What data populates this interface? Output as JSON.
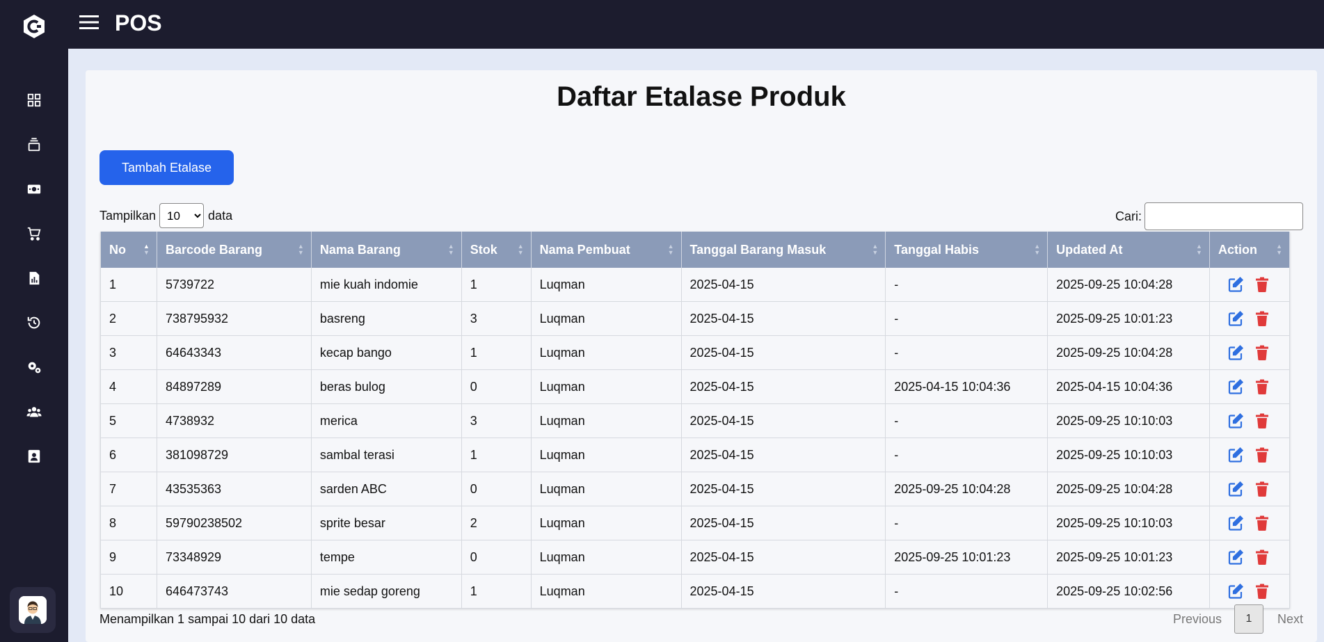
{
  "app": {
    "title": "POS"
  },
  "page": {
    "title": "Daftar Etalase Produk"
  },
  "actions": {
    "add_label": "Tambah Etalase"
  },
  "length_control": {
    "prefix": "Tampilkan",
    "suffix": "data",
    "selected": "10"
  },
  "search": {
    "label": "Cari:",
    "value": ""
  },
  "table": {
    "headers": [
      "No",
      "Barcode Barang",
      "Nama Barang",
      "Stok",
      "Nama Pembuat",
      "Tanggal Barang Masuk",
      "Tanggal Habis",
      "Updated At",
      "Action"
    ],
    "rows": [
      [
        "1",
        "5739722",
        "mie kuah indomie",
        "1",
        "Luqman",
        "2025-04-15",
        "-",
        "2025-09-25 10:04:28"
      ],
      [
        "2",
        "738795932",
        "basreng",
        "3",
        "Luqman",
        "2025-04-15",
        "-",
        "2025-09-25 10:01:23"
      ],
      [
        "3",
        "64643343",
        "kecap bango",
        "1",
        "Luqman",
        "2025-04-15",
        "-",
        "2025-09-25 10:04:28"
      ],
      [
        "4",
        "84897289",
        "beras bulog",
        "0",
        "Luqman",
        "2025-04-15",
        "2025-04-15 10:04:36",
        "2025-04-15 10:04:36"
      ],
      [
        "5",
        "4738932",
        "merica",
        "3",
        "Luqman",
        "2025-04-15",
        "-",
        "2025-09-25 10:10:03"
      ],
      [
        "6",
        "381098729",
        "sambal terasi",
        "1",
        "Luqman",
        "2025-04-15",
        "-",
        "2025-09-25 10:10:03"
      ],
      [
        "7",
        "43535363",
        "sarden ABC",
        "0",
        "Luqman",
        "2025-04-15",
        "2025-09-25 10:04:28",
        "2025-09-25 10:04:28"
      ],
      [
        "8",
        "59790238502",
        "sprite besar",
        "2",
        "Luqman",
        "2025-04-15",
        "-",
        "2025-09-25 10:10:03"
      ],
      [
        "9",
        "73348929",
        "tempe",
        "0",
        "Luqman",
        "2025-04-15",
        "2025-09-25 10:01:23",
        "2025-09-25 10:01:23"
      ],
      [
        "10",
        "646473743",
        "mie sedap goreng",
        "1",
        "Luqman",
        "2025-04-15",
        "-",
        "2025-09-25 10:02:56"
      ]
    ]
  },
  "footer": {
    "info": "Menampilkan 1 sampai 10 dari 10 data",
    "previous": "Previous",
    "page": "1",
    "next": "Next"
  },
  "colors": {
    "sidebar": "#1c1c2e",
    "accent": "#2563eb",
    "table_header": "#8b9bb8",
    "edit_icon": "#2f6fe0",
    "delete_icon": "#e03a3a"
  }
}
